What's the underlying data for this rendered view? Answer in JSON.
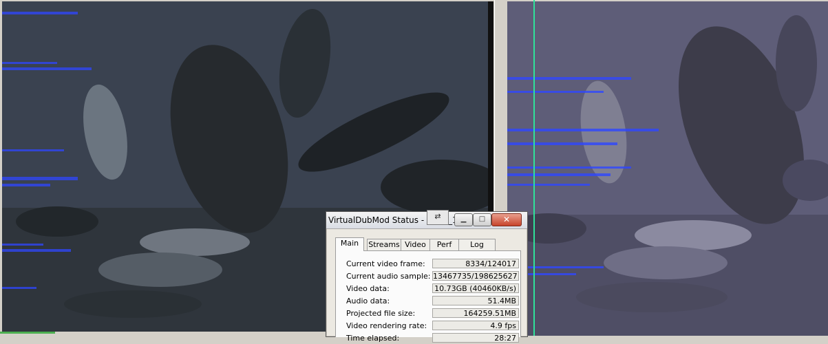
{
  "dialog": {
    "title": "VirtualDubMod Status - [DVD_1...",
    "tabs": [
      {
        "label": "Main",
        "active": true
      },
      {
        "label": "Streams",
        "active": false
      },
      {
        "label": "Video",
        "active": false
      },
      {
        "label": "Perf",
        "active": false
      },
      {
        "label": "Log",
        "active": false
      }
    ],
    "rows": [
      {
        "label": "Current video frame:",
        "value": "8334/124017"
      },
      {
        "label": "Current audio sample:",
        "value": "13467735/198625627"
      },
      {
        "label": "Video data:",
        "value": "10.73GB (40460KB/s)"
      },
      {
        "label": "Audio data:",
        "value": "51.4MB"
      },
      {
        "label": "Projected file size:",
        "value": "164259.51MB"
      },
      {
        "label": "Video rendering rate:",
        "value": "4.9 fps"
      },
      {
        "label": "Time elapsed:",
        "value": "28:27"
      }
    ],
    "buttons": {
      "minimize": "▁",
      "maximize": "□",
      "close": "✕"
    }
  },
  "panes": {
    "input_tint": "#3a4048",
    "output_tint": "#5b5a73",
    "artifact_color": "#2f47ff",
    "cursor_color": "#2fe39a"
  }
}
